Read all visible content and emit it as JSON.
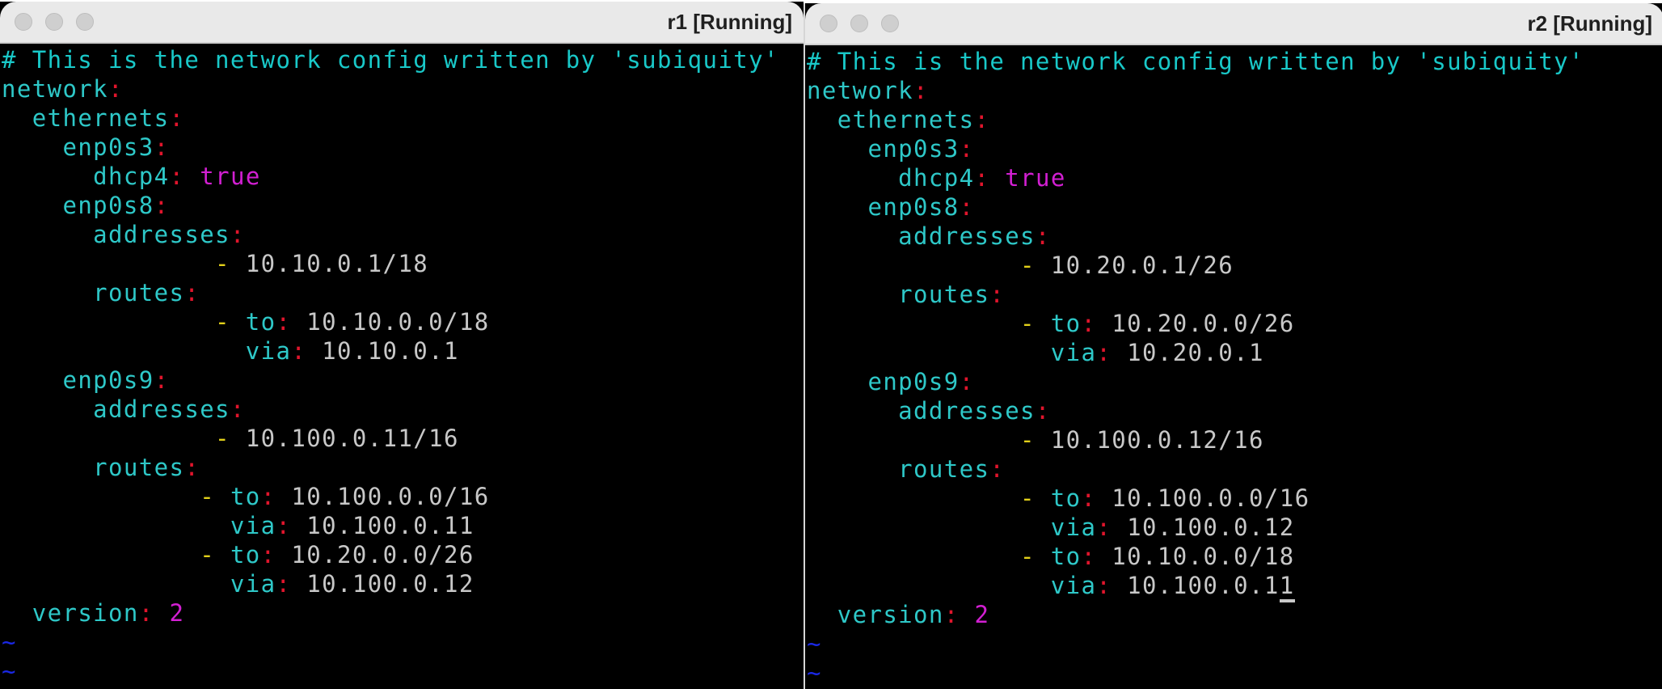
{
  "windows": [
    {
      "title": "r1 [Running]",
      "header_comment": "# This is the network config written by 'subiquity'",
      "network_key": "network",
      "ethernets_key": "ethernets",
      "if1": "enp0s3",
      "dhcp4_key": "dhcp4",
      "dhcp4_val": "true",
      "if2": "enp0s8",
      "addresses_key": "addresses",
      "if2_address": "10.10.0.1/18",
      "routes_key": "routes",
      "to_key": "to",
      "via_key": "via",
      "if2_route_to": "10.10.0.0/18",
      "if2_route_via": "10.10.0.1",
      "if3": "enp0s9",
      "if3_address": "10.100.0.11/16",
      "if3_route1_to": "10.100.0.0/16",
      "if3_route1_via": "10.100.0.11",
      "if3_route2_to": "10.20.0.0/26",
      "if3_route2_via": "10.100.0.12",
      "version_key": "version",
      "version_val": "2",
      "tilde": "~"
    },
    {
      "title": "r2 [Running]",
      "header_comment": "# This is the network config written by 'subiquity'",
      "network_key": "network",
      "ethernets_key": "ethernets",
      "if1": "enp0s3",
      "dhcp4_key": "dhcp4",
      "dhcp4_val": "true",
      "if2": "enp0s8",
      "addresses_key": "addresses",
      "if2_address": "10.20.0.1/26",
      "routes_key": "routes",
      "to_key": "to",
      "via_key": "via",
      "if2_route_to": "10.20.0.0/26",
      "if2_route_via": "10.20.0.1",
      "if3": "enp0s9",
      "if3_address": "10.100.0.12/16",
      "if3_route1_to": "10.100.0.0/16",
      "if3_route1_via": "10.100.0.12",
      "if3_route2_to": "10.10.0.0/18",
      "if3_route2_via_main": "10.100.0.1",
      "if3_route2_via_cursor": "1",
      "version_key": "version",
      "version_val": "2",
      "tilde": "~"
    }
  ],
  "colors": {
    "comment": "#19c8c8",
    "key": "#2ec8c8",
    "colon": "#e0152c",
    "boolean_number": "#d21fd2",
    "list_dash": "#e2d01a",
    "value": "#c8c8c8",
    "tilde": "#1a28e6"
  }
}
